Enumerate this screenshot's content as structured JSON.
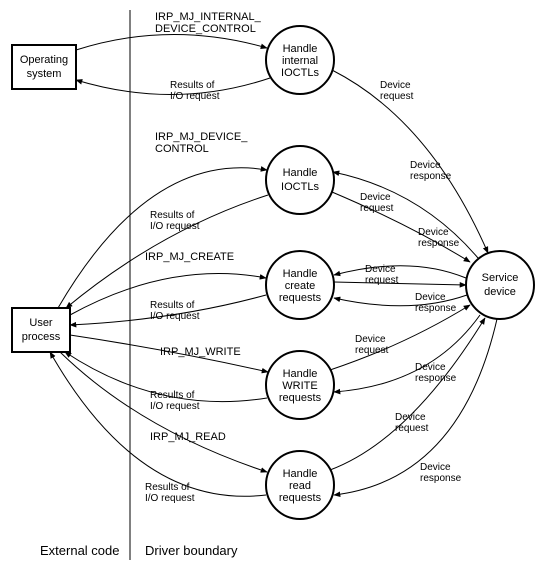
{
  "nodes": {
    "os": {
      "label1": "Operating",
      "label2": "system"
    },
    "user": {
      "label1": "User",
      "label2": "process"
    },
    "h1": {
      "label1": "Handle",
      "label2": "internal",
      "label3": "IOCTLs"
    },
    "h2": {
      "label1": "Handle",
      "label2": "IOCTLs"
    },
    "h3": {
      "label1": "Handle",
      "label2": "create",
      "label3": "requests"
    },
    "h4": {
      "label1": "Handle",
      "label2": "WRITE",
      "label3": "requests"
    },
    "h5": {
      "label1": "Handle",
      "label2": "read",
      "label3": "requests"
    },
    "svc": {
      "label1": "Service",
      "label2": "device"
    }
  },
  "edges": {
    "e1": {
      "label1": "IRP_MJ_INTERNAL_",
      "label2": "DEVICE_CONTROL"
    },
    "e2": {
      "label1": "Results of",
      "label2": "I/O request"
    },
    "e3": {
      "label1": "IRP_MJ_DEVICE_",
      "label2": "CONTROL"
    },
    "e4": {
      "label1": "Results of",
      "label2": "I/O request"
    },
    "e5": {
      "label": "IRP_MJ_CREATE"
    },
    "e6": {
      "label1": "Results of",
      "label2": "I/O request"
    },
    "e7": {
      "label": "IRP_MJ_WRITE"
    },
    "e8": {
      "label1": "Results of",
      "label2": "I/O request"
    },
    "e9": {
      "label": "IRP_MJ_READ"
    },
    "e10": {
      "label1": "Results of",
      "label2": "I/O request"
    },
    "dreq1": {
      "label1": "Device",
      "label2": "request"
    },
    "dresp2a": {
      "label1": "Device",
      "label2": "response"
    },
    "dreq2": {
      "label1": "Device",
      "label2": "request"
    },
    "dresp3a": {
      "label1": "Device",
      "label2": "response"
    },
    "dreq3": {
      "label1": "Device",
      "label2": "request"
    },
    "dresp3b": {
      "label1": "Device",
      "label2": "response"
    },
    "dreq4": {
      "label1": "Device",
      "label2": "request"
    },
    "dresp4": {
      "label1": "Device",
      "label2": "response"
    },
    "dreq5": {
      "label1": "Device",
      "label2": "request"
    },
    "dresp5": {
      "label1": "Device",
      "label2": "response"
    }
  },
  "regions": {
    "left": "External code",
    "right": "Driver boundary"
  }
}
